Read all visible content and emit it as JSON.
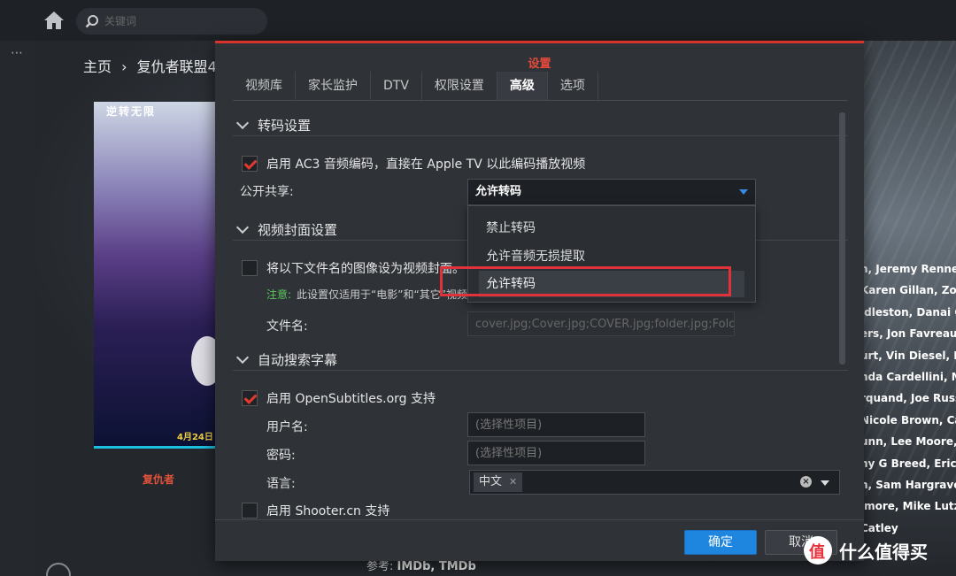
{
  "topbar": {
    "search_placeholder": "关键词"
  },
  "breadcrumb": {
    "home": "主页",
    "sep": "›",
    "current": "复仇者联盟4"
  },
  "poster": {
    "title_text": "逆转无限",
    "play": "",
    "logo": "复仇者",
    "date": "4月24日"
  },
  "cast_lines": [
    "n, Jeremy Renner",
    "Karen Gillan, Zoe",
    "ldleston, Danai G",
    "ers, Jon Favreau",
    "urt, Vin Diesel, B",
    "nda Cardellini, M",
    "rquand, Joe Russ",
    "Nicole Brown, Ca",
    "unn, Lee Moore, I",
    "ny G Breed, Erica",
    "n, Sam Hargrave",
    "lmore, Mike Lutz",
    "Catley"
  ],
  "reference": {
    "label": "参考:",
    "value": "IMDb, TMDb"
  },
  "dialog": {
    "title": "设置",
    "tabs": [
      "视频库",
      "家长监护",
      "DTV",
      "权限设置",
      "高级",
      "选项"
    ],
    "active_tab": "高级",
    "transcode": {
      "section": "转码设置",
      "ac3_label": "启用 AC3 音频编码，直接在 Apple TV 以此编码播放视频",
      "share_label": "公开共享:",
      "share_value": "允许转码",
      "options": [
        "禁止转码",
        "允许音频无损提取",
        "允许转码"
      ]
    },
    "cover": {
      "section": "视频封面设置",
      "checkbox_label": "将以下文件名的图像设为视频封面。",
      "note_tag": "注意:",
      "note_text": "此设置仅适用于“电影”和“其它”视频类",
      "filename_label": "文件名:",
      "filename_value": "cover.jpg;Cover.jpg;COVER.jpg;folder.jpg;Folder.jpg"
    },
    "subtitles": {
      "section": "自动搜索字幕",
      "opensub_label": "启用 OpenSubtitles.org 支持",
      "username_label": "用户名:",
      "username_placeholder": "(选择性项目)",
      "password_label": "密码:",
      "password_placeholder": "(选择性项目)",
      "language_label": "语言:",
      "language_tag": "中文",
      "shooter_label": "启用 Shooter.cn 支持"
    },
    "ok_label": "确定",
    "cancel_label": "取消"
  },
  "watermark": {
    "text": "什么值得买"
  },
  "colors": {
    "accent": "#1f86e0",
    "title_red": "#e64a3a",
    "check_red": "#e03b2e",
    "highlight_red": "#e0323a"
  }
}
